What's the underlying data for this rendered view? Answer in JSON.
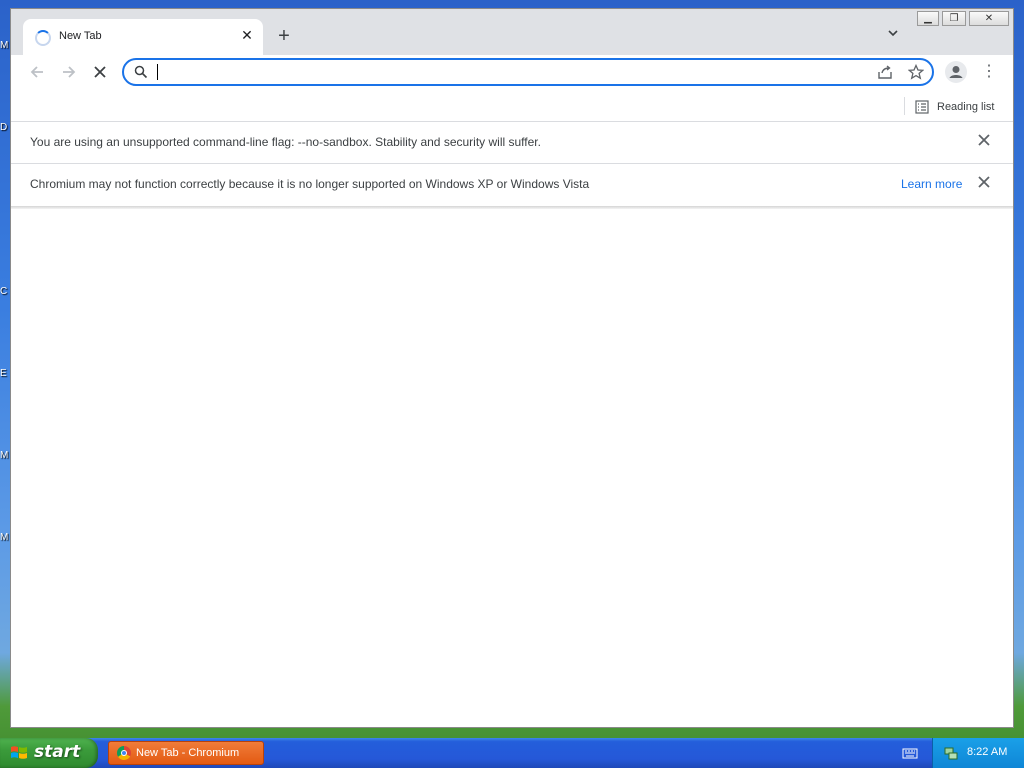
{
  "desktop": {
    "edge_letters": [
      "M",
      "D",
      "C",
      "E",
      "M",
      "M"
    ]
  },
  "browser": {
    "tab": {
      "title": "New Tab",
      "close_icon": "close-icon",
      "state": "loading"
    },
    "new_tab_icon": "plus-icon",
    "tab_search_icon": "chevron-down-icon",
    "window_controls": {
      "minimize": "minimize-icon",
      "restore": "restore-icon",
      "close": "close-icon"
    },
    "toolbar": {
      "back_icon": "arrow-left-icon",
      "forward_icon": "arrow-right-icon",
      "stop_icon": "stop-icon",
      "omnibox": {
        "value": "",
        "placeholder": ""
      },
      "share_icon": "share-icon",
      "bookmark_icon": "star-icon",
      "profile_icon": "profile-icon",
      "menu_icon": "kebab-menu-icon"
    },
    "bookmarks_bar": {
      "reading_list_label": "Reading list"
    },
    "infobars": [
      {
        "text": "You are using an unsupported command-line flag: --no-sandbox. Stability and security will suffer.",
        "link": ""
      },
      {
        "text": "Chromium may not function correctly because it is no longer supported on Windows XP or Windows Vista",
        "link": "Learn more"
      }
    ]
  },
  "taskbar": {
    "start_label": "start",
    "tasks": [
      {
        "label": "New Tab - Chromium"
      }
    ],
    "clock": "8:22 AM"
  },
  "colors": {
    "accent": "#1a73e8",
    "tabstrip": "#dfe1e5",
    "taskbar": "#245edb",
    "start_button": "#3b9b3b",
    "active_task": "#e35a12"
  }
}
